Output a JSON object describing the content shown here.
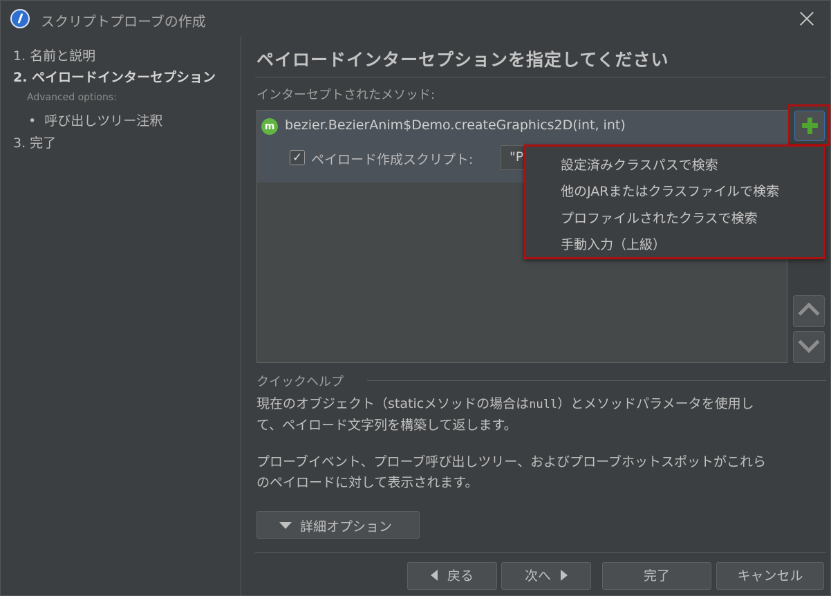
{
  "window": {
    "title": "スクリプトプローブの作成"
  },
  "steps": {
    "step1": "1. 名前と説明",
    "step2": "2. ペイロードインターセプション",
    "advanced": "Advanced options:",
    "sub_item": "呼び出しツリー注釈",
    "step3": "3. 完了"
  },
  "main": {
    "heading": "ペイロードインターセプションを指定してください",
    "list_label": "インターセプトされたメソッド:",
    "method_icon": "m",
    "method": "bezier.BezierAnim$Demo.createGraphics2D(int, int)",
    "checkbox_label": "ペイロード作成スクリプト:",
    "checkbox_checked": true,
    "script_value": "\"P"
  },
  "popup_menu": {
    "items": [
      "設定済みクラスパスで検索",
      "他のJARまたはクラスファイルで検索",
      "プロファイルされたクラスで検索",
      "手動入力（上級）"
    ]
  },
  "quick_help": {
    "title": "クイックヘルプ",
    "p1_a": "現在のオブジェクト（static",
    "p1_b": "メソッドの場合は",
    "p1_null": "null",
    "p1_c": "）とメソッドパラメータを使用し",
    "p1_d": "て、ペイロード文字列を構築して返します。",
    "p2_a": "プローブイベント、プローブ呼び出しツリー、およびプローブホットスポットがこれら",
    "p2_b": "のペイロードに対して表示されます。"
  },
  "details_button": "詳細オプション",
  "footer": {
    "back": "戻る",
    "next": "次へ",
    "finish": "完了",
    "cancel": "キャンセル"
  },
  "colors": {
    "background": "#3c3f41",
    "highlight_border": "#b00f0f",
    "add_green": "#4fa52f",
    "selected_row": "#4b5259"
  },
  "icons": [
    "app-icon",
    "close-icon",
    "method-icon",
    "add-icon",
    "move-up-icon",
    "move-down-icon",
    "chevron-down-icon",
    "arrow-left-icon",
    "arrow-right-icon"
  ]
}
